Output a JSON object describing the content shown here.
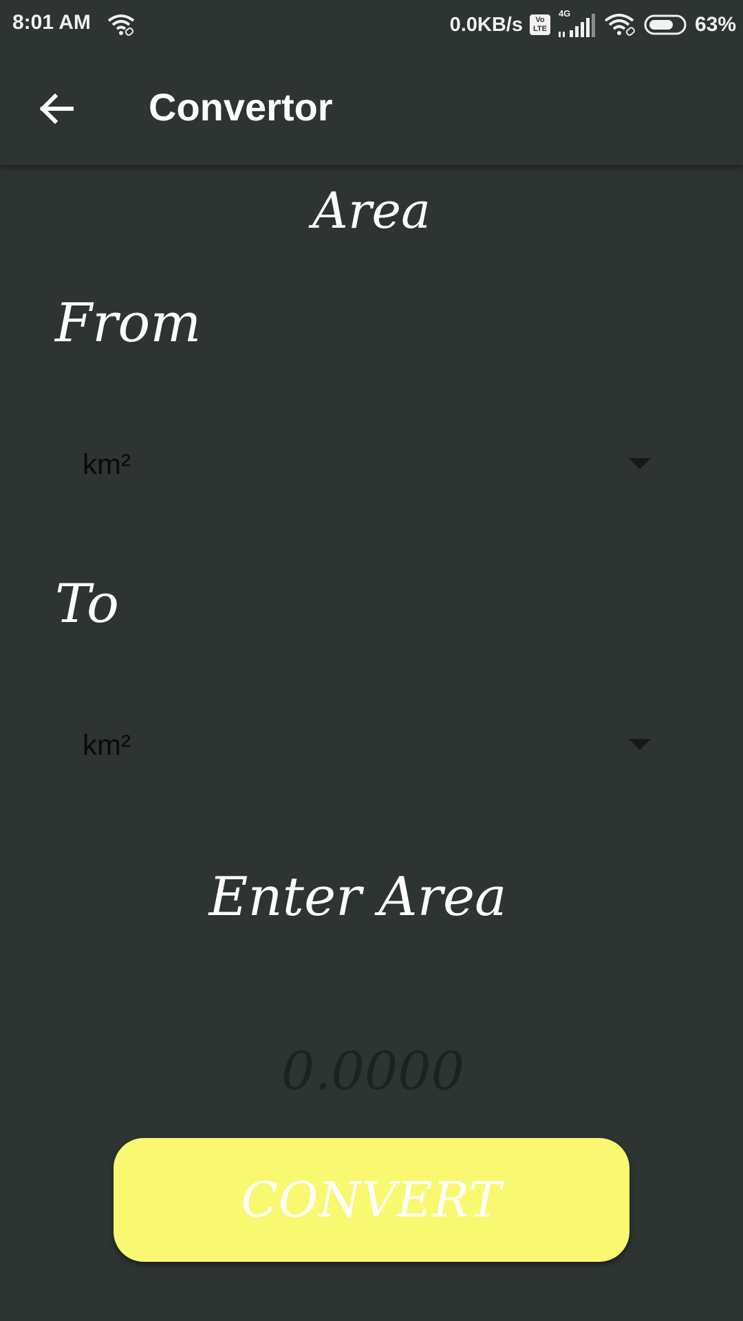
{
  "status_bar": {
    "time": "8:01 AM",
    "network_speed": "0.0KB/s",
    "volte_label_top": "Vo",
    "volte_label_bottom": "LTE",
    "network_type": "4G",
    "battery_percent": "63%",
    "icons": [
      "wifi-link-icon",
      "volte-icon",
      "signal-icon",
      "wifi-icon",
      "battery-icon"
    ]
  },
  "app_bar": {
    "title": "Convertor",
    "back_icon": "arrow-left-icon"
  },
  "main": {
    "section_title": "Area",
    "from_label": "From",
    "from_selected": "km²",
    "to_label": "To",
    "to_selected": "km²",
    "enter_label": "Enter Area",
    "input_placeholder": "0.0000",
    "input_value": "",
    "convert_label": "CONVERT"
  },
  "colors": {
    "background": "#2d3432",
    "button": "#f9f871",
    "text": "#ffffff",
    "placeholder": "#1c2220"
  }
}
